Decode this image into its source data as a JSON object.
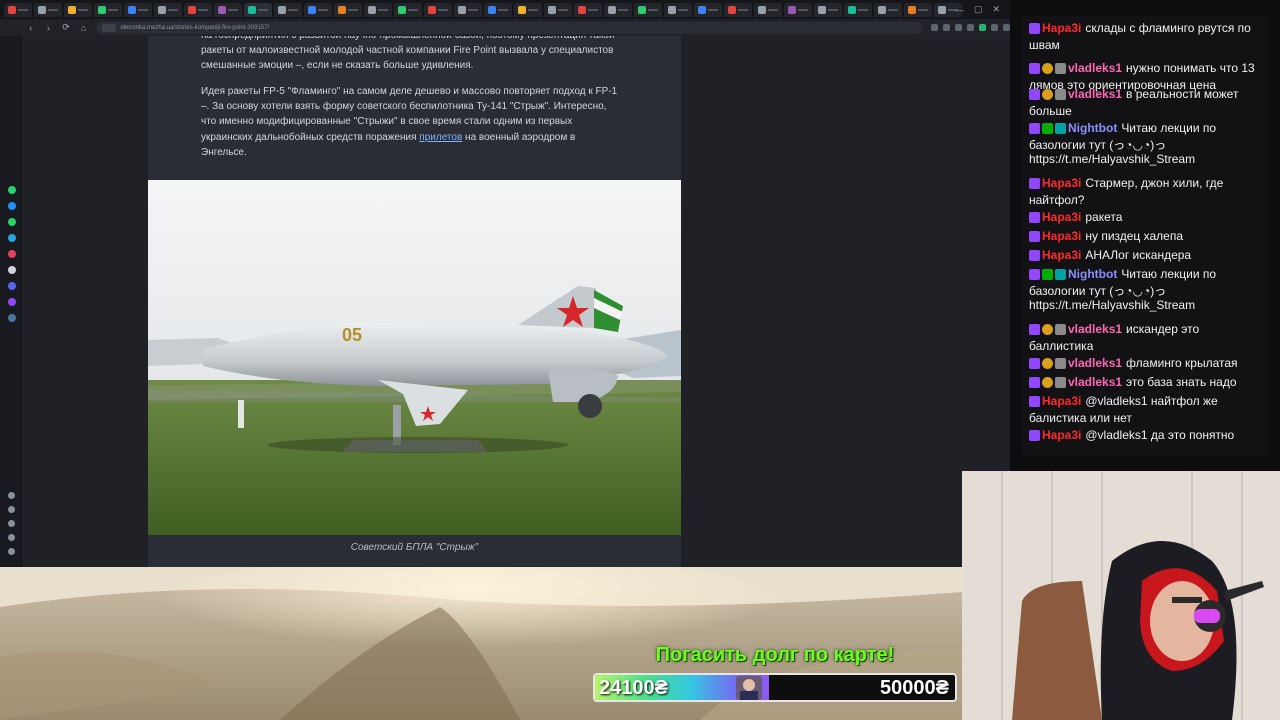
{
  "browser": {
    "url": "oboronka.mezha.ua/stories-kompaniji-fire-point-309157/",
    "nav": {
      "back": "‹",
      "forward": "›",
      "reload": "⟳",
      "home": "⌂"
    },
    "window_controls": {
      "minimize": "—",
      "maximize": "▢",
      "close": "✕"
    }
  },
  "article": {
    "paragraph_1": "на госпредприятия с развитой научно-промышленной базой, поэтому презентация такой ракеты от малоизвестной молодой частной компании Fire Point вызвала у специалистов смешанные эмоции –, если не сказать больше удивления.",
    "paragraph_2_before": "Идея ракеты FP-5 \"Фламинго\" на самом деле дешево и массово повторяет подход к FP-1 –. За основу хотели взять форму советского беспилотника Ту-141 \"Стрыж\". Интересно, что именно модифицированные \"Стрыжи\" в свое время стали одним из первых украинских дальнобойных средств поражения ",
    "paragraph_2_link": "прилетов",
    "paragraph_2_after": " на военный аэродром в Энгельсе.",
    "caption": "Советский БПЛА \"Стрыж\"",
    "plane_marking": "05"
  },
  "chat": {
    "colors": {
      "red": "#ff2a2a",
      "pink": "#ff69b4",
      "blue": "#8a8fff"
    },
    "messages": [
      {
        "name": "Нара3і",
        "text": "склады с фламинго рвутся по швам"
      },
      {
        "name": "vladleks1",
        "text": "нужно понимать что 13 лямов это ориентировочная цена"
      },
      {
        "name": "vladleks1",
        "text": "в реальности может больше"
      },
      {
        "name": "Nightbot",
        "text": "Читаю лекции по базологии тут (っ◔◡◔)っ https://t.me/Halyavshik_Stream"
      },
      {
        "name": "Нара3і",
        "text": "Стармер, джон хили, где найтфол?"
      },
      {
        "name": "Нара3і",
        "text": "ракета"
      },
      {
        "name": "Нара3і",
        "text": "ну пиздец халепа"
      },
      {
        "name": "Нара3і",
        "text": "АНАЛог искандера"
      },
      {
        "name": "Nightbot",
        "text": "Читаю лекции по базологии тут (っ◔◡◔)っ https://t.me/Halyavshik_Stream"
      },
      {
        "name": "vladleks1",
        "text": "искандер это баллистика"
      },
      {
        "name": "vladleks1",
        "text": "фламинго крылатая"
      },
      {
        "name": "vladleks1",
        "text": "это база знать надо"
      },
      {
        "name": "Нара3і",
        "text": "@vladleks1 найтфол же балистика или нет"
      },
      {
        "name": "Нара3і",
        "text": "@vladleks1 да это понятно"
      }
    ]
  },
  "donation_goal": {
    "title": "Погасить долг по карте!",
    "current": "24100₴",
    "target": "50000₴",
    "progress_fraction": 0.482
  }
}
